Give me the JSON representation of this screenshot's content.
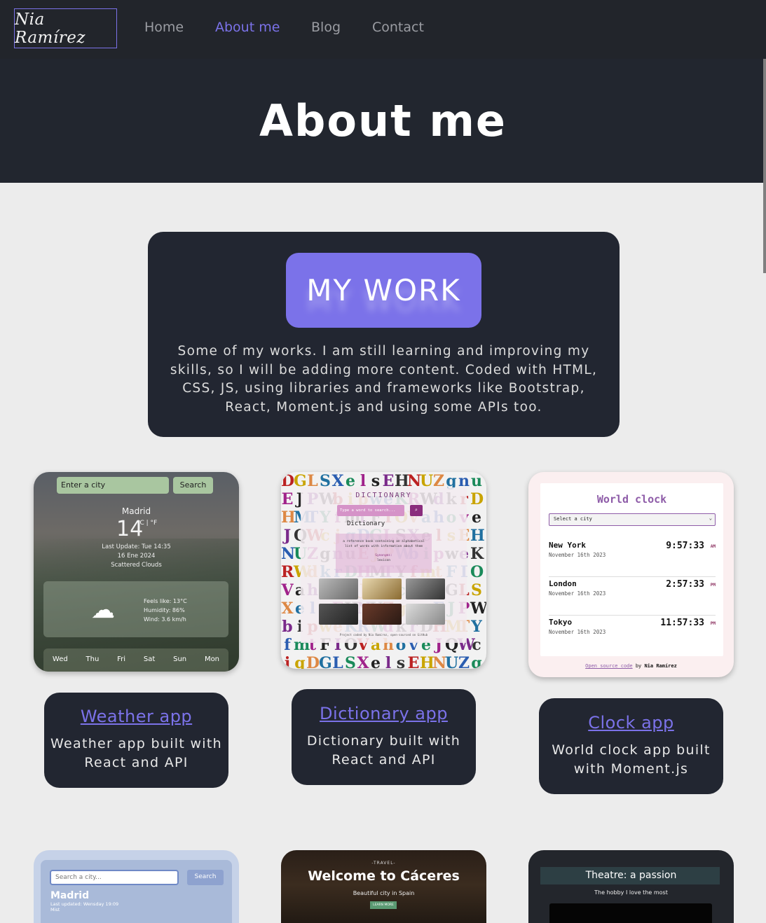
{
  "nav": {
    "brand": "Nia Ramírez",
    "links": [
      {
        "label": "Home",
        "active": false
      },
      {
        "label": "About me",
        "active": true
      },
      {
        "label": "Blog",
        "active": false
      },
      {
        "label": "Contact",
        "active": false
      }
    ]
  },
  "header": {
    "title": "About me"
  },
  "intro": {
    "button": "MY WORK",
    "text": "Some of my works. I am still learning and improving my skills, so I will be adding more content. Coded with HTML, CSS, JS, using libraries and frameworks like Bootstrap, React, Moment.js and using some APIs too."
  },
  "projects": [
    {
      "title": "Weather app",
      "desc": "Weather app built with React and API"
    },
    {
      "title": "Dictionary app",
      "desc": "Dictionary built with React and API"
    },
    {
      "title": "Clock app",
      "desc": "World clock app built with Moment.js"
    }
  ],
  "weather_thumb": {
    "input": "Enter a city",
    "search": "Search",
    "city": "Madrid",
    "temp": "14",
    "unit": "°C | °F",
    "last_update": "Last Update: Tue 14:35",
    "date": "16 Ene 2024",
    "condition": "Scattered Clouds",
    "feels": "Feels like: 13°C",
    "humidity": "Humidity: 86%",
    "wind": "Wind: 3.6 km/h",
    "days": [
      "Wed",
      "Thu",
      "Fri",
      "Sat",
      "Sun",
      "Mon"
    ]
  },
  "dict_thumb": {
    "title": "DICTIONARY",
    "input": "Type a word to search...",
    "word": "Dictionary",
    "def_1": "a reference book containing an alphabetical",
    "def_2": "list of words with information about them",
    "synonyms": "Synonyms:",
    "syn": "lexicon",
    "footer": "Project coded by Nia Ramírez, open-sourced on GitHub"
  },
  "clock_thumb": {
    "title": "World clock",
    "select": "Select a city",
    "rows": [
      {
        "city": "New York",
        "date": "November 16th 2023",
        "time": "9:57:33",
        "ampm": "AM"
      },
      {
        "city": "London",
        "date": "November 16th 2023",
        "time": "2:57:33",
        "ampm": "PM"
      },
      {
        "city": "Tokyo",
        "date": "November 16th 2023",
        "time": "11:57:33",
        "ampm": "PM"
      }
    ],
    "footer_link": "Open source code",
    "footer_by": "by",
    "footer_name": "Nia Ramírez"
  },
  "row2": {
    "weather2": {
      "input": "Search a city...",
      "search": "Search",
      "city": "Madrid",
      "updated": "Last updated: Wensday 19:09",
      "cond": "Mist"
    },
    "caceres": {
      "tag": "-TRAVEL-",
      "title": "Welcome to Cáceres",
      "sub": "Beautiful city in Spain",
      "btn": "LEARN MORE"
    },
    "theatre": {
      "title": "Theatre: a passion",
      "sub": "The hobby I love the most"
    }
  },
  "colors": {
    "accent": "#7b72e9",
    "dark": "#222631"
  }
}
